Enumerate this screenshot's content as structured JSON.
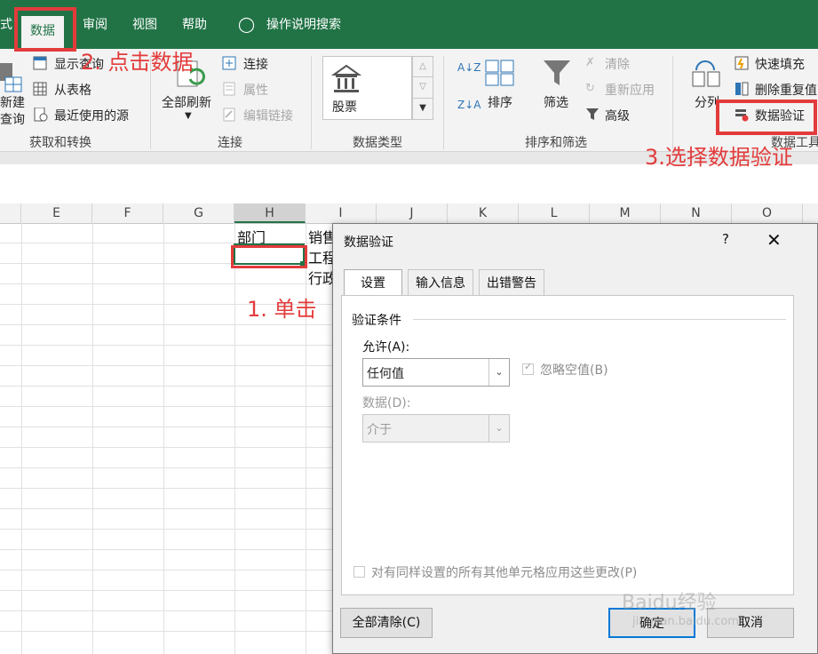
{
  "menubar": {
    "items": [
      "式",
      "数据",
      "审阅",
      "视图",
      "帮助",
      "操作说明搜索"
    ],
    "accent": "#217346"
  },
  "ribbon": {
    "get_transform": {
      "label": "获取和转换",
      "new_query_line1": "新建",
      "new_query_line2": "查询",
      "show_queries": "显示查询",
      "from_table": "从表格",
      "recent_sources": "最近使用的源"
    },
    "connections": {
      "label": "连接",
      "refresh_all": "全部刷新",
      "connections": "连接",
      "properties": "属性",
      "edit_links": "编辑链接"
    },
    "data_types": {
      "label": "数据类型",
      "stocks": "股票"
    },
    "sort_filter": {
      "label": "排序和筛选",
      "sort": "排序",
      "filter": "筛选",
      "clear": "清除",
      "reapply": "重新应用",
      "advanced": "高级"
    },
    "data_tools": {
      "label": "数据工具",
      "text_to_columns": "分列",
      "flash_fill": "快速填充",
      "remove_duplicates": "删除重复值",
      "data_validation": "数据验证"
    }
  },
  "grid": {
    "columns": [
      "E",
      "F",
      "G",
      "H",
      "I",
      "J",
      "K",
      "L",
      "M",
      "N",
      "O"
    ],
    "cells": {
      "h1": "部门",
      "i1": "销售",
      "i2": "工程",
      "i3": "行政"
    }
  },
  "annotations": {
    "step1": "1. 单击",
    "step2": "2. 点击数据",
    "step3": "3.选择数据验证",
    "color": "#e33b3b"
  },
  "dialog": {
    "title": "数据验证",
    "help": "?",
    "close": "✕",
    "tabs": [
      "设置",
      "输入信息",
      "出错警告"
    ],
    "criteria_heading": "验证条件",
    "allow_label": "允许(A):",
    "allow_value": "任何值",
    "ignore_blank": "忽略空值(B)",
    "data_label": "数据(D):",
    "data_value": "介于",
    "apply_all": "对有同样设置的所有其他单元格应用这些更改(P)",
    "clear_all": "全部清除(C)",
    "ok": "确定",
    "cancel": "取消"
  },
  "watermark": "Baidu经验 jingyan.baidu.com"
}
